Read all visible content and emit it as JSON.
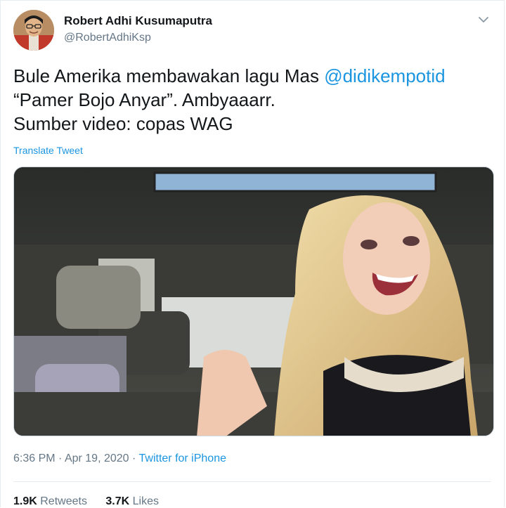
{
  "author": {
    "name": "Robert Adhi Kusumaputra",
    "handle": "@RobertAdhiKsp"
  },
  "tweet": {
    "text_before": "Bule Amerika membawakan lagu Mas ",
    "mention": "@didikempotid",
    "text_after": "\n “Pamer Bojo Anyar”. Ambyaaarr.\nSumber video: copas WAG",
    "translate_label": "Translate Tweet"
  },
  "meta": {
    "time": "6:36 PM",
    "separator1": " · ",
    "date": "Apr 19, 2020",
    "separator2": " · ",
    "source": "Twitter for iPhone"
  },
  "stats": {
    "retweets_count": "1.9K",
    "retweets_label": "Retweets",
    "likes_count": "3.7K",
    "likes_label": "Likes"
  },
  "colors": {
    "link": "#1b95e0",
    "secondary_text": "#657786",
    "border": "#e6ecf0"
  },
  "icons": {
    "caret": "chevron-down-icon"
  }
}
